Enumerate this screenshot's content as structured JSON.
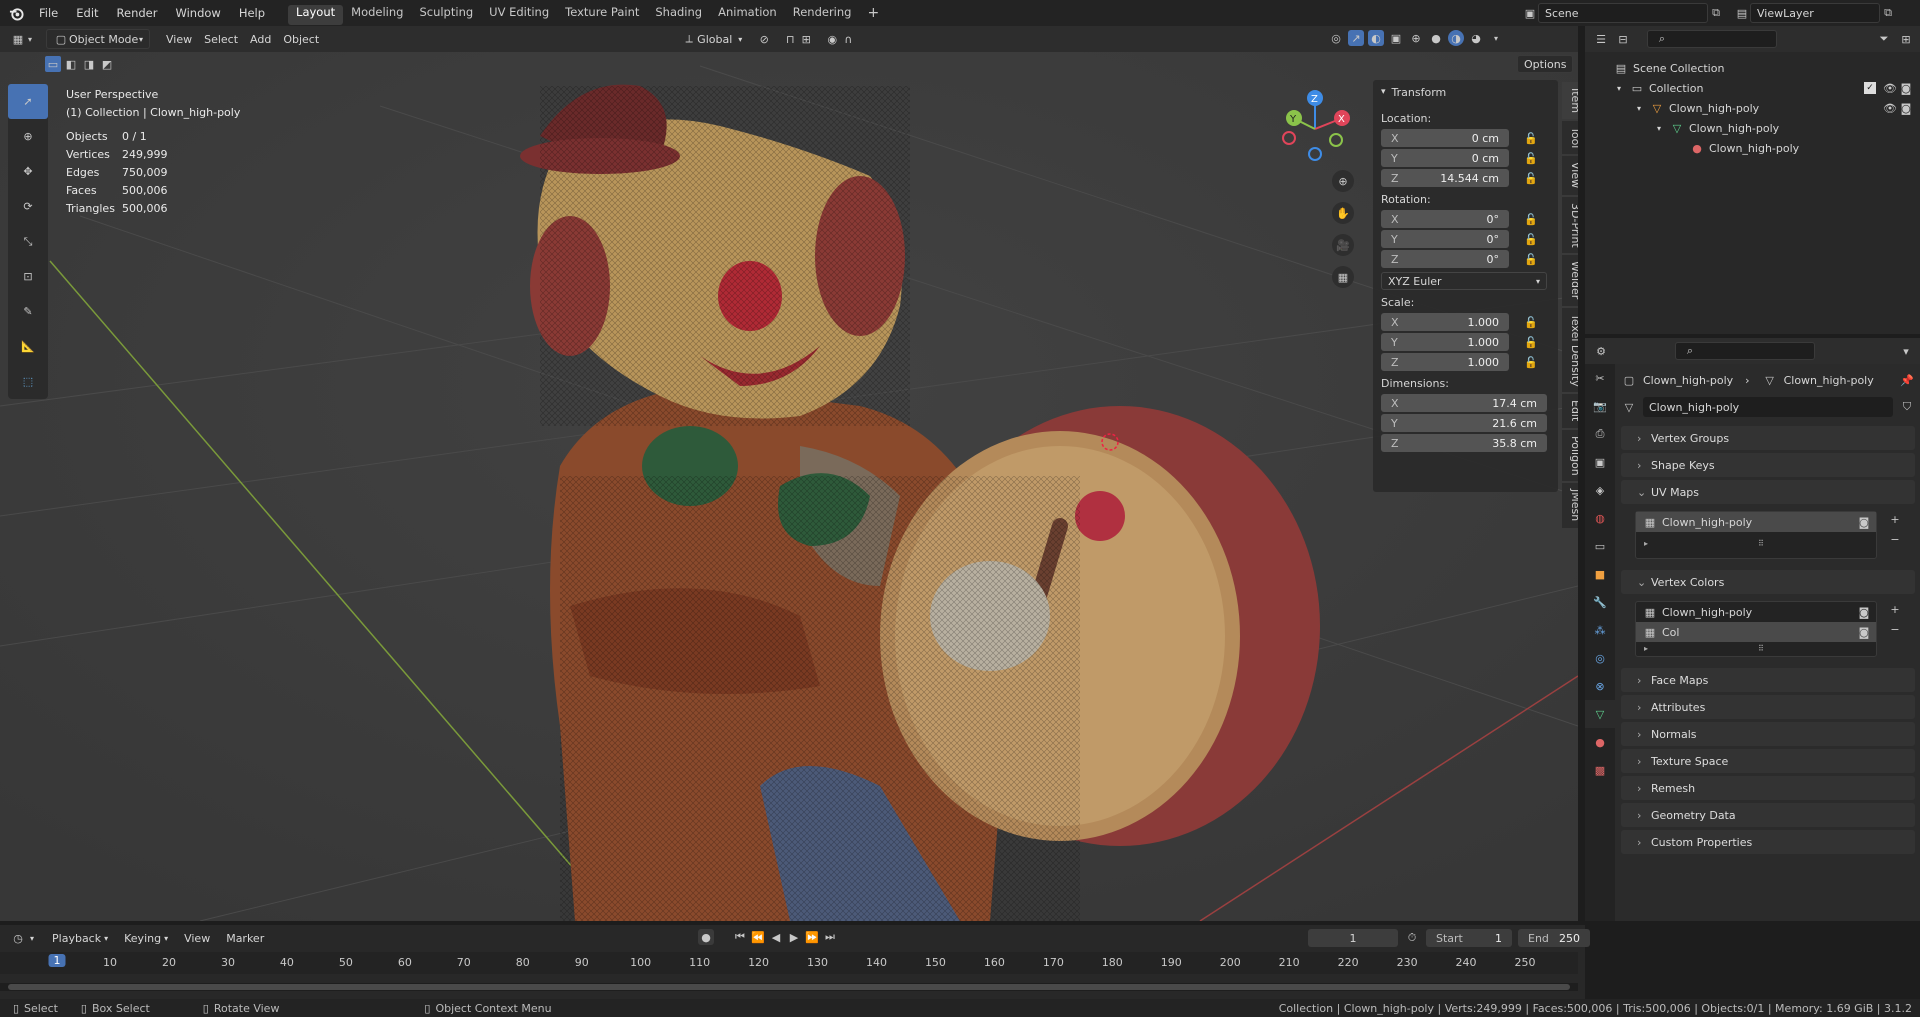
{
  "topbar": {
    "menus": [
      "File",
      "Edit",
      "Render",
      "Window",
      "Help"
    ],
    "workspaces": [
      "Layout",
      "Modeling",
      "Sculpting",
      "UV Editing",
      "Texture Paint",
      "Shading",
      "Animation",
      "Rendering"
    ],
    "active_workspace": "Layout",
    "add_workspace": "+",
    "scene": "Scene",
    "view_layer": "ViewLayer"
  },
  "viewport_header": {
    "mode": "Object Mode",
    "menus": [
      "View",
      "Select",
      "Add",
      "Object"
    ],
    "orientation": "Global",
    "options": "Options"
  },
  "overlay": {
    "perspective": "User Perspective",
    "collection_line": "(1) Collection | Clown_high-poly",
    "stats": [
      {
        "label": "Objects",
        "value": "0 / 1"
      },
      {
        "label": "Vertices",
        "value": "249,999"
      },
      {
        "label": "Edges",
        "value": "750,009"
      },
      {
        "label": "Faces",
        "value": "500,006"
      },
      {
        "label": "Triangles",
        "value": "500,006"
      }
    ]
  },
  "npanel": {
    "title": "Transform",
    "location_label": "Location:",
    "location": [
      {
        "axis": "X",
        "value": "0 cm"
      },
      {
        "axis": "Y",
        "value": "0 cm"
      },
      {
        "axis": "Z",
        "value": "14.544 cm"
      }
    ],
    "rotation_label": "Rotation:",
    "rotation": [
      {
        "axis": "X",
        "value": "0°"
      },
      {
        "axis": "Y",
        "value": "0°"
      },
      {
        "axis": "Z",
        "value": "0°"
      }
    ],
    "rotation_mode": "XYZ Euler",
    "scale_label": "Scale:",
    "scale": [
      {
        "axis": "X",
        "value": "1.000"
      },
      {
        "axis": "Y",
        "value": "1.000"
      },
      {
        "axis": "Z",
        "value": "1.000"
      }
    ],
    "dimensions_label": "Dimensions:",
    "dimensions": [
      {
        "axis": "X",
        "value": "17.4 cm"
      },
      {
        "axis": "Y",
        "value": "21.6 cm"
      },
      {
        "axis": "Z",
        "value": "35.8 cm"
      }
    ],
    "tabs": [
      "Item",
      "Tool",
      "View",
      "3D-Print",
      "Welder",
      "Texel Density",
      "Edit",
      "Poligon",
      "JMesh"
    ]
  },
  "gizmo": {
    "x": "X",
    "y": "Y",
    "z": "Z"
  },
  "outliner": {
    "rows": [
      {
        "label": "Scene Collection",
        "indent": 0
      },
      {
        "label": "Collection",
        "indent": 1
      },
      {
        "label": "Clown_high-poly",
        "indent": 2
      },
      {
        "label": "Clown_high-poly",
        "indent": 3
      },
      {
        "label": "Clown_high-poly",
        "indent": 4
      }
    ]
  },
  "properties": {
    "breadcrumb_object": "Clown_high-poly",
    "breadcrumb_data": "Clown_high-poly",
    "datablock_name": "Clown_high-poly",
    "panels": {
      "vertex_groups": "Vertex Groups",
      "shape_keys": "Shape Keys",
      "uv_maps": "UV Maps",
      "vertex_colors": "Vertex Colors",
      "face_maps": "Face Maps",
      "attributes": "Attributes",
      "normals": "Normals",
      "texture_space": "Texture Space",
      "remesh": "Remesh",
      "geometry_data": "Geometry Data",
      "custom_properties": "Custom Properties"
    },
    "uv_map_items": [
      "Clown_high-poly"
    ],
    "vertex_color_items": [
      "Clown_high-poly",
      "Col"
    ]
  },
  "timeline": {
    "menus": [
      "Playback",
      "Keying",
      "View",
      "Marker"
    ],
    "current_frame": "1",
    "start_label": "Start",
    "start": "1",
    "end_label": "End",
    "end": "250",
    "ticks": [
      "1",
      "10",
      "20",
      "30",
      "40",
      "50",
      "60",
      "70",
      "80",
      "90",
      "100",
      "110",
      "120",
      "130",
      "140",
      "150",
      "160",
      "170",
      "180",
      "190",
      "200",
      "210",
      "220",
      "230",
      "240",
      "250"
    ]
  },
  "statusbar": {
    "select": "Select",
    "box_select": "Box Select",
    "rotate_view": "Rotate View",
    "context_menu": "Object Context Menu",
    "info": "Collection | Clown_high-poly | Verts:249,999 | Faces:500,006 | Tris:500,006 | Objects:0/1 | Memory: 1.69 GiB | 3.1.2"
  },
  "colors": {
    "accent": "#4772b3",
    "x_axis": "#e0455a",
    "y_axis": "#8bc34a",
    "z_axis": "#3e8ce6"
  }
}
